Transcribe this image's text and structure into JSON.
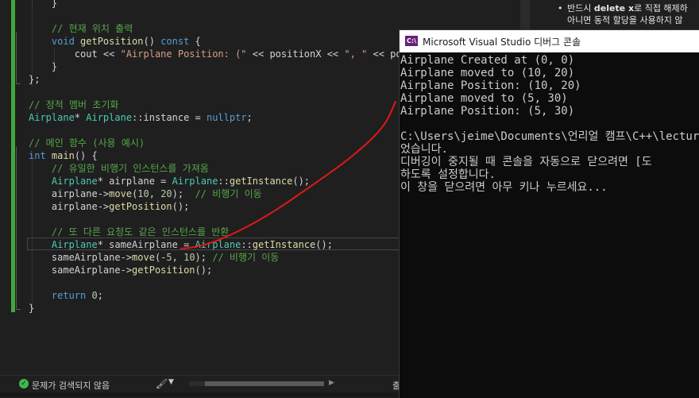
{
  "editor": {
    "lines": [
      [
        {
          "t": "    }",
          "c": "pl"
        }
      ],
      [
        {
          "t": "",
          "c": "pl"
        }
      ],
      [
        {
          "t": "    // 현재 위치 출력",
          "c": "cm"
        }
      ],
      [
        {
          "t": "    ",
          "c": "pl"
        },
        {
          "t": "void ",
          "c": "kw"
        },
        {
          "t": "getPosition",
          "c": "fn"
        },
        {
          "t": "() ",
          "c": "pl"
        },
        {
          "t": "const",
          "c": "kw"
        },
        {
          "t": " {",
          "c": "pl"
        }
      ],
      [
        {
          "t": "        cout << ",
          "c": "pl"
        },
        {
          "t": "\"Airplane Position: (\"",
          "c": "st"
        },
        {
          "t": " << positionX << ",
          "c": "pl"
        },
        {
          "t": "\", \"",
          "c": "st"
        },
        {
          "t": " << positionY",
          "c": "pl"
        }
      ],
      [
        {
          "t": "    }",
          "c": "pl"
        }
      ],
      [
        {
          "t": "};",
          "c": "pl"
        }
      ],
      [
        {
          "t": "",
          "c": "pl"
        }
      ],
      [
        {
          "t": "// 정적 멤버 초기화",
          "c": "cm"
        }
      ],
      [
        {
          "t": "Airplane",
          "c": "ty"
        },
        {
          "t": "* ",
          "c": "pl"
        },
        {
          "t": "Airplane",
          "c": "ty"
        },
        {
          "t": "::instance = ",
          "c": "pl"
        },
        {
          "t": "nullptr",
          "c": "kw"
        },
        {
          "t": ";",
          "c": "pl"
        }
      ],
      [
        {
          "t": "",
          "c": "pl"
        }
      ],
      [
        {
          "t": "// 메인 함수 (사용 예시)",
          "c": "cm"
        }
      ],
      [
        {
          "t": "int ",
          "c": "kw"
        },
        {
          "t": "main",
          "c": "fn"
        },
        {
          "t": "() {",
          "c": "pl"
        }
      ],
      [
        {
          "t": "    // 유일한 비행기 인스턴스를 가져옴",
          "c": "cm"
        }
      ],
      [
        {
          "t": "    ",
          "c": "pl"
        },
        {
          "t": "Airplane",
          "c": "ty"
        },
        {
          "t": "* airplane = ",
          "c": "pl"
        },
        {
          "t": "Airplane",
          "c": "ty"
        },
        {
          "t": "::",
          "c": "pl"
        },
        {
          "t": "getInstance",
          "c": "fn"
        },
        {
          "t": "();",
          "c": "pl"
        }
      ],
      [
        {
          "t": "    airplane->",
          "c": "pl"
        },
        {
          "t": "move",
          "c": "fn"
        },
        {
          "t": "(",
          "c": "pl"
        },
        {
          "t": "10",
          "c": "nm"
        },
        {
          "t": ", ",
          "c": "pl"
        },
        {
          "t": "20",
          "c": "nm"
        },
        {
          "t": ");  ",
          "c": "pl"
        },
        {
          "t": "// 비행기 이동",
          "c": "cm"
        }
      ],
      [
        {
          "t": "    airplane->",
          "c": "pl"
        },
        {
          "t": "getPosition",
          "c": "fn"
        },
        {
          "t": "();",
          "c": "pl"
        }
      ],
      [
        {
          "t": "",
          "c": "pl"
        }
      ],
      [
        {
          "t": "    // 또 다른 요청도 같은 인스턴스를 반환",
          "c": "cm"
        }
      ],
      [
        {
          "t": "    ",
          "c": "pl"
        },
        {
          "t": "Airplane",
          "c": "ty"
        },
        {
          "t": "* sameAirplane = ",
          "c": "pl"
        },
        {
          "t": "Airplane",
          "c": "ty"
        },
        {
          "t": "::",
          "c": "pl"
        },
        {
          "t": "getInstance",
          "c": "fn"
        },
        {
          "t": "();",
          "c": "pl"
        }
      ],
      [
        {
          "t": "    sameAirplane->",
          "c": "pl"
        },
        {
          "t": "move",
          "c": "fn"
        },
        {
          "t": "(-",
          "c": "pl"
        },
        {
          "t": "5",
          "c": "nm"
        },
        {
          "t": ", ",
          "c": "pl"
        },
        {
          "t": "10",
          "c": "nm"
        },
        {
          "t": "); ",
          "c": "pl"
        },
        {
          "t": "// 비행기 이동",
          "c": "cm"
        }
      ],
      [
        {
          "t": "    sameAirplane->",
          "c": "pl"
        },
        {
          "t": "getPosition",
          "c": "fn"
        },
        {
          "t": "();",
          "c": "pl"
        }
      ],
      [
        {
          "t": "",
          "c": "pl"
        }
      ],
      [
        {
          "t": "    return ",
          "c": "kw"
        },
        {
          "t": "0",
          "c": "nm"
        },
        {
          "t": ";",
          "c": "pl"
        }
      ],
      [
        {
          "t": "}",
          "c": "pl"
        }
      ]
    ]
  },
  "status_bar": {
    "message": "문제가 검색되지 않음",
    "ok_icon": "check-circle-icon",
    "brush_icon": "brush-icon",
    "extra": "출"
  },
  "doc_panel": {
    "line1_prefix": "반드시 ",
    "line1_bold": "delete x",
    "line1_suffix": "로 직접 해제하",
    "line2": "아니면 동적 할당을 사용하지 않"
  },
  "console": {
    "title": "Microsoft Visual Studio 디버그 콘솔",
    "icon_label": "C:\\",
    "lines": [
      "Airplane Created at (0, 0)",
      "Airplane moved to (10, 20)",
      "Airplane Position: (10, 20)",
      "Airplane moved to (5, 30)",
      "Airplane Position: (5, 30)",
      "",
      "C:\\Users\\jeime\\Documents\\언리얼 캠프\\C++\\lecture",
      "었습니다.",
      "디버깅이 중지될 때 콘솔을 자동으로 닫으려면 [도",
      "하도록 설정합니다.",
      "이 창을 닫으려면 아무 키나 누르세요..."
    ]
  },
  "annotation": {
    "stroke_color": "#e01818"
  }
}
